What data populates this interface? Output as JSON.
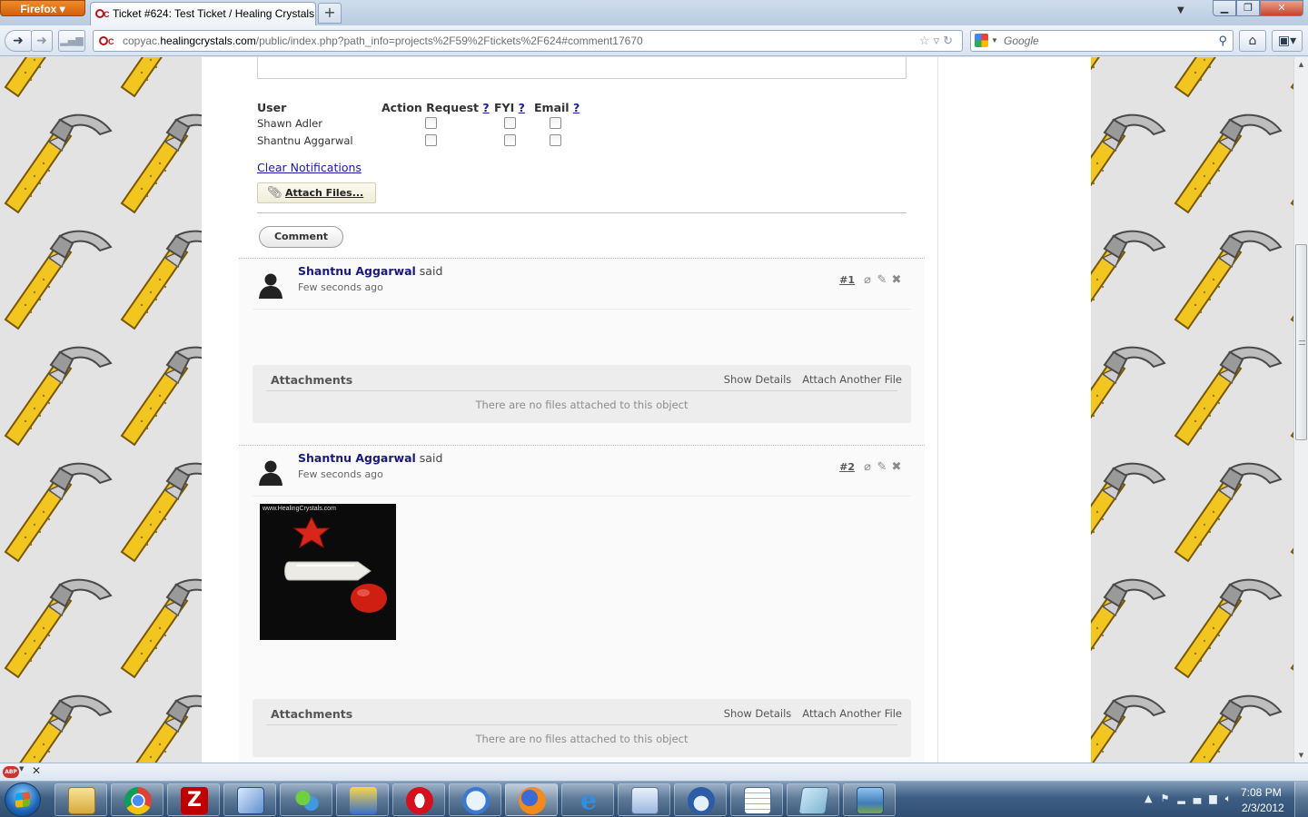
{
  "browser": {
    "app_button": "Firefox",
    "tab_title": "Ticket #624: Test Ticket / Healing Crystals",
    "new_tab_label": "+",
    "url_prefix": "copyac.",
    "url_host": "healingcrystals.com",
    "url_path": "/public/index.php?path_info=projects%2F59%2Ftickets%2F624#comment17670",
    "search_placeholder": "Google",
    "colors": {
      "accent": "#e66000",
      "link": "#1a1aa6",
      "author": "#1a1a7e"
    }
  },
  "notifications": {
    "headers": {
      "user": "User",
      "action_request": "Action Request",
      "fyi": "FYI",
      "email": "Email",
      "help": "?"
    },
    "users": [
      {
        "name": "Shawn Adler",
        "action_request": false,
        "fyi": false,
        "email": false
      },
      {
        "name": "Shantnu Aggarwal",
        "action_request": false,
        "fyi": false,
        "email": false
      }
    ],
    "clear_label": "Clear Notifications"
  },
  "form": {
    "attach_files_label": "Attach Files...",
    "comment_button": "Comment"
  },
  "comments": [
    {
      "number": "#1",
      "author": "Shantnu Aggarwal",
      "said": "said",
      "time": "Few seconds ago",
      "attachments": {
        "title": "Attachments",
        "show_details": "Show Details",
        "attach_another": "Attach Another File",
        "empty": "There are no files attached to this object"
      }
    },
    {
      "number": "#2",
      "author": "Shantnu Aggarwal",
      "said": "said",
      "time": "Few seconds ago",
      "image_caption": "www.HealingCrystals.com",
      "attachments": {
        "title": "Attachments",
        "show_details": "Show Details",
        "attach_another": "Attach Another File",
        "empty": "There are no files attached to this object"
      }
    }
  ],
  "scroll": {
    "position_fraction": 0.36
  },
  "taskbar": {
    "apps": [
      "windows-explorer",
      "google-chrome",
      "filezilla",
      "virtualbox",
      "messenger",
      "network-tool",
      "opera",
      "safari",
      "firefox",
      "internet-explorer",
      "remote-desktop",
      "thunderbird",
      "openoffice-calc",
      "notepad",
      "image-viewer"
    ],
    "time": "7:08 PM",
    "date": "2/3/2012"
  }
}
